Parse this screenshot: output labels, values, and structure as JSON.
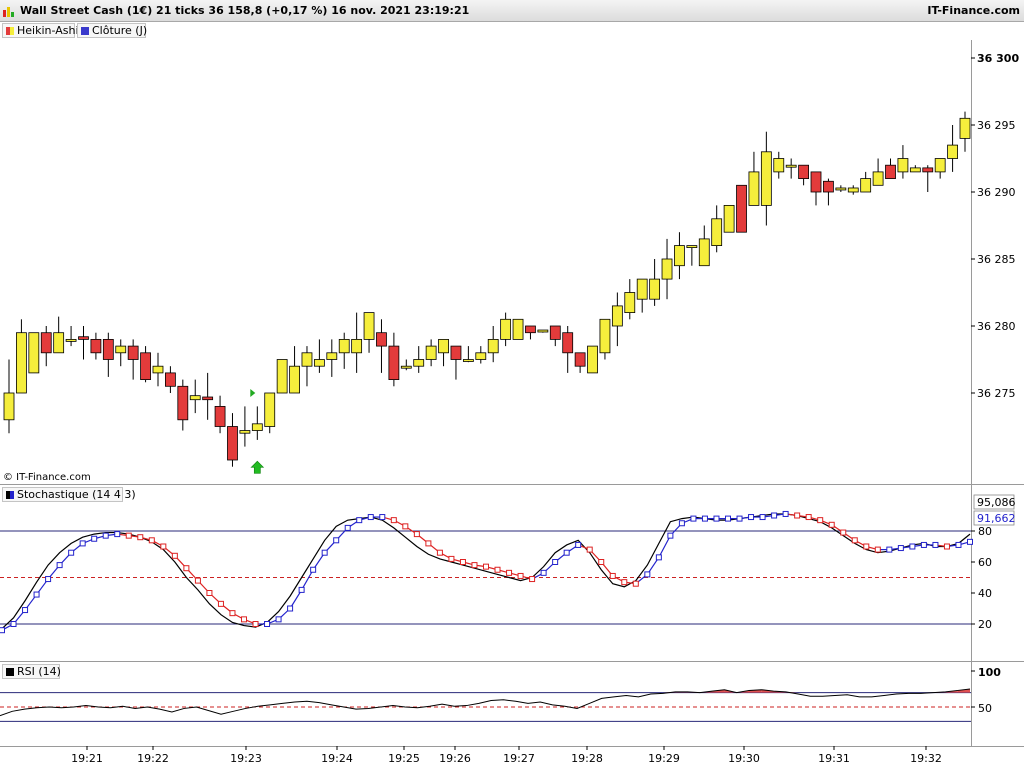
{
  "header": {
    "title": "Wall Street Cash (1€) 21 ticks 36 158,8 (+0,17 %) 16 nov. 2021 23:19:21",
    "brand": "IT-Finance.com"
  },
  "legend": [
    {
      "label": "Heikin-Ashi",
      "color": "#e8c400"
    },
    {
      "label": "Clôture (J)",
      "color": "#3a3acc"
    }
  ],
  "copyright": "© IT-Finance.com",
  "colors": {
    "bull": "#f5ee3c",
    "bear": "#e33b3b",
    "stoch_k": "#000000",
    "stoch_d_up": "#2323cc",
    "stoch_d_down": "#dd2222",
    "rsi": "#000000",
    "rsi_fill": "#e05050"
  },
  "chart_data": [
    {
      "type": "candlestick",
      "name": "Heikin-Ashi",
      "y_ticks": [
        {
          "value": 36300,
          "label": "36 300",
          "bold": true
        },
        {
          "value": 36295,
          "label": "36 295"
        },
        {
          "value": 36290,
          "label": "36 290"
        },
        {
          "value": 36285,
          "label": "36 285"
        },
        {
          "value": 36280,
          "label": "36 280"
        },
        {
          "value": 36275,
          "label": "36 275"
        }
      ],
      "x_ticks": [
        "19:21",
        "19:22",
        "19:23",
        "19:24",
        "19:25",
        "19:26",
        "19:27",
        "19:28",
        "19:29",
        "19:30",
        "19:31",
        "19:32"
      ],
      "candles": [
        [
          36273.0,
          36275.0,
          36272.0,
          36277.5
        ],
        [
          36275.0,
          36279.5,
          36275.0,
          36280.5
        ],
        [
          36276.5,
          36279.5,
          36276.5,
          36279.5
        ],
        [
          36279.5,
          36278.0,
          36277.0,
          36280.0
        ],
        [
          36278.0,
          36279.5,
          36278.0,
          36280.7
        ],
        [
          36279.0,
          36279.0,
          36278.5,
          36280.0
        ],
        [
          36279.2,
          36279.0,
          36277.5,
          36280.0
        ],
        [
          36279.0,
          36278.0,
          36277.5,
          36279.5
        ],
        [
          36279.0,
          36277.5,
          36276.2,
          36279.5
        ],
        [
          36278.0,
          36278.5,
          36277.0,
          36279.0
        ],
        [
          36278.5,
          36277.5,
          36276.0,
          36279.0
        ],
        [
          36278.0,
          36276.0,
          36275.8,
          36278.5
        ],
        [
          36276.5,
          36277.0,
          36275.5,
          36278.0
        ],
        [
          36276.5,
          36275.5,
          36275.0,
          36277.0
        ],
        [
          36275.5,
          36273.0,
          36272.2,
          36276.0
        ],
        [
          36274.5,
          36274.8,
          36273.5,
          36276.0
        ],
        [
          36274.7,
          36274.5,
          36273.0,
          36276.5
        ],
        [
          36274.0,
          36272.5,
          36272.0,
          36274.8
        ],
        [
          36272.5,
          36270.0,
          36269.5,
          36273.5
        ],
        [
          36272.0,
          36272.2,
          36271.0,
          36274.0
        ],
        [
          36272.2,
          36272.7,
          36271.5,
          36274.0
        ],
        [
          36272.5,
          36275.0,
          36272.0,
          36275.0
        ],
        [
          36275.0,
          36277.5,
          36275.0,
          36277.5
        ],
        [
          36275.0,
          36277.0,
          36275.0,
          36278.5
        ],
        [
          36277.0,
          36278.0,
          36275.5,
          36278.5
        ],
        [
          36277.0,
          36277.5,
          36276.5,
          36279.0
        ],
        [
          36277.5,
          36278.0,
          36276.2,
          36279.0
        ],
        [
          36278.0,
          36279.0,
          36276.8,
          36279.5
        ],
        [
          36278.0,
          36279.0,
          36276.5,
          36281.0
        ],
        [
          36279.0,
          36281.0,
          36278.0,
          36281.0
        ],
        [
          36279.5,
          36278.5,
          36276.5,
          36280.5
        ],
        [
          36278.5,
          36276.0,
          36275.5,
          36279.5
        ],
        [
          36277.0,
          36277.0,
          36276.7,
          36277.5
        ],
        [
          36277.0,
          36277.5,
          36276.5,
          36278.5
        ],
        [
          36277.5,
          36278.5,
          36277.0,
          36279.0
        ],
        [
          36278.0,
          36279.0,
          36277.0,
          36279.0
        ],
        [
          36278.5,
          36277.5,
          36276.0,
          36278.5
        ],
        [
          36277.5,
          36277.5,
          36277.3,
          36278.5
        ],
        [
          36277.5,
          36278.0,
          36277.2,
          36278.5
        ],
        [
          36278.0,
          36279.0,
          36277.3,
          36280.0
        ],
        [
          36279.0,
          36280.5,
          36278.5,
          36281.0
        ],
        [
          36279.0,
          36280.5,
          36279.0,
          36280.5
        ],
        [
          36280.0,
          36279.5,
          36279.0,
          36279.5
        ],
        [
          36279.7,
          36279.7,
          36279.5,
          36279.7
        ],
        [
          36280.0,
          36279.0,
          36278.5,
          36280.0
        ],
        [
          36279.5,
          36278.0,
          36276.5,
          36280.0
        ],
        [
          36278.0,
          36277.0,
          36276.5,
          36278.0
        ],
        [
          36276.5,
          36278.5,
          36276.5,
          36278.5
        ],
        [
          36278.0,
          36280.5,
          36277.5,
          36280.5
        ],
        [
          36280.0,
          36281.5,
          36278.5,
          36282.5
        ],
        [
          36281.0,
          36282.5,
          36280.5,
          36283.5
        ],
        [
          36282.0,
          36283.5,
          36281.0,
          36283.5
        ],
        [
          36282.0,
          36283.5,
          36281.5,
          36285.0
        ],
        [
          36283.5,
          36285.0,
          36282.0,
          36286.5
        ],
        [
          36284.5,
          36286.0,
          36283.5,
          36287.0
        ],
        [
          36286.0,
          36286.0,
          36284.5,
          36286.0
        ],
        [
          36284.5,
          36286.5,
          36284.5,
          36287.5
        ],
        [
          36286.0,
          36288.0,
          36285.5,
          36289.0
        ],
        [
          36287.0,
          36289.0,
          36287.0,
          36289.0
        ],
        [
          36290.5,
          36287.0,
          36287.0,
          36290.5
        ],
        [
          36289.0,
          36291.5,
          36289.0,
          36293.0
        ],
        [
          36289.0,
          36293.0,
          36287.5,
          36294.5
        ],
        [
          36291.5,
          36292.5,
          36291.0,
          36293.0
        ],
        [
          36292.0,
          36292.0,
          36291.0,
          36292.5
        ],
        [
          36292.0,
          36291.0,
          36290.5,
          36292.0
        ],
        [
          36291.5,
          36290.0,
          36289.0,
          36291.5
        ],
        [
          36290.8,
          36290.0,
          36289.0,
          36291.0
        ],
        [
          36290.3,
          36290.3,
          36290.0,
          36290.5
        ],
        [
          36290.0,
          36290.3,
          36289.8,
          36290.5
        ],
        [
          36290.0,
          36291.0,
          36290.0,
          36291.5
        ],
        [
          36290.5,
          36291.5,
          36290.5,
          36292.5
        ],
        [
          36292.0,
          36291.0,
          36291.0,
          36292.5
        ],
        [
          36291.5,
          36292.5,
          36291.0,
          36293.5
        ],
        [
          36291.5,
          36291.8,
          36291.5,
          36292.0
        ],
        [
          36291.8,
          36291.5,
          36290.0,
          36292.0
        ],
        [
          36291.5,
          36292.5,
          36291.0,
          36292.5
        ],
        [
          36292.5,
          36293.5,
          36291.5,
          36295.0
        ],
        [
          36294.0,
          36295.5,
          36293.0,
          36296.0
        ]
      ],
      "markers": [
        {
          "kind": "green-triangle-right",
          "index": 20,
          "value": 36275.0
        },
        {
          "kind": "green-up-arrow",
          "index": 20,
          "value": 36270.5
        }
      ]
    },
    {
      "type": "line",
      "name": "Stochastique (14 4 3)",
      "y_ticks": [
        20,
        40,
        60,
        80
      ],
      "levels": [
        20,
        50,
        80
      ],
      "last_values": [
        95.086,
        91.662
      ],
      "last_labels": [
        "95,086",
        "91,662"
      ],
      "series": [
        {
          "key": "k",
          "values": [
            17,
            24,
            35,
            47,
            58,
            66,
            72,
            76,
            78,
            79,
            79,
            78,
            76,
            73,
            68,
            60,
            50,
            42,
            33,
            26,
            21,
            19,
            18,
            21,
            28,
            38,
            50,
            62,
            74,
            83,
            87,
            88,
            89,
            87,
            82,
            76,
            70,
            65,
            62,
            60,
            58,
            56,
            54,
            52,
            50,
            48,
            50,
            57,
            66,
            71,
            74,
            66,
            55,
            46,
            44,
            48,
            58,
            72,
            86,
            88,
            89,
            88,
            87,
            87,
            88,
            89,
            90,
            91,
            91,
            90,
            88,
            86,
            82,
            77,
            72,
            68,
            66,
            67,
            69,
            71,
            72,
            70,
            70,
            72,
            78
          ]
        },
        {
          "key": "d",
          "values": [
            16,
            20,
            29,
            39,
            49,
            58,
            66,
            72,
            75,
            77,
            78,
            77,
            76,
            74,
            70,
            64,
            56,
            48,
            40,
            33,
            27,
            23,
            20,
            20,
            23,
            30,
            42,
            55,
            66,
            74,
            82,
            87,
            89,
            89,
            87,
            83,
            78,
            72,
            66,
            62,
            60,
            58,
            57,
            55,
            53,
            51,
            49,
            53,
            60,
            66,
            71,
            68,
            60,
            51,
            47,
            46,
            52,
            63,
            77,
            85,
            88,
            88,
            88,
            88,
            88,
            89,
            89,
            90,
            91,
            90,
            89,
            87,
            84,
            79,
            74,
            70,
            68,
            68,
            69,
            70,
            71,
            71,
            70,
            71,
            73
          ]
        }
      ]
    },
    {
      "type": "area",
      "name": "RSI (14)",
      "y_ticks": [
        50,
        100
      ],
      "levels": [
        30,
        50,
        70
      ],
      "values": [
        38,
        44,
        47,
        49,
        50,
        49,
        50,
        52,
        50,
        49,
        51,
        48,
        50,
        47,
        43,
        48,
        50,
        45,
        40,
        44,
        48,
        51,
        53,
        55,
        57,
        58,
        56,
        53,
        50,
        47,
        48,
        50,
        52,
        50,
        49,
        51,
        54,
        51,
        52,
        55,
        59,
        60,
        58,
        55,
        57,
        53,
        51,
        48,
        55,
        62,
        64,
        66,
        64,
        68,
        69,
        71,
        71,
        70,
        72,
        74,
        70,
        73,
        74,
        72,
        71,
        68,
        65,
        65,
        66,
        67,
        64,
        64,
        66,
        68,
        69,
        69,
        70,
        71,
        73,
        75
      ]
    }
  ]
}
